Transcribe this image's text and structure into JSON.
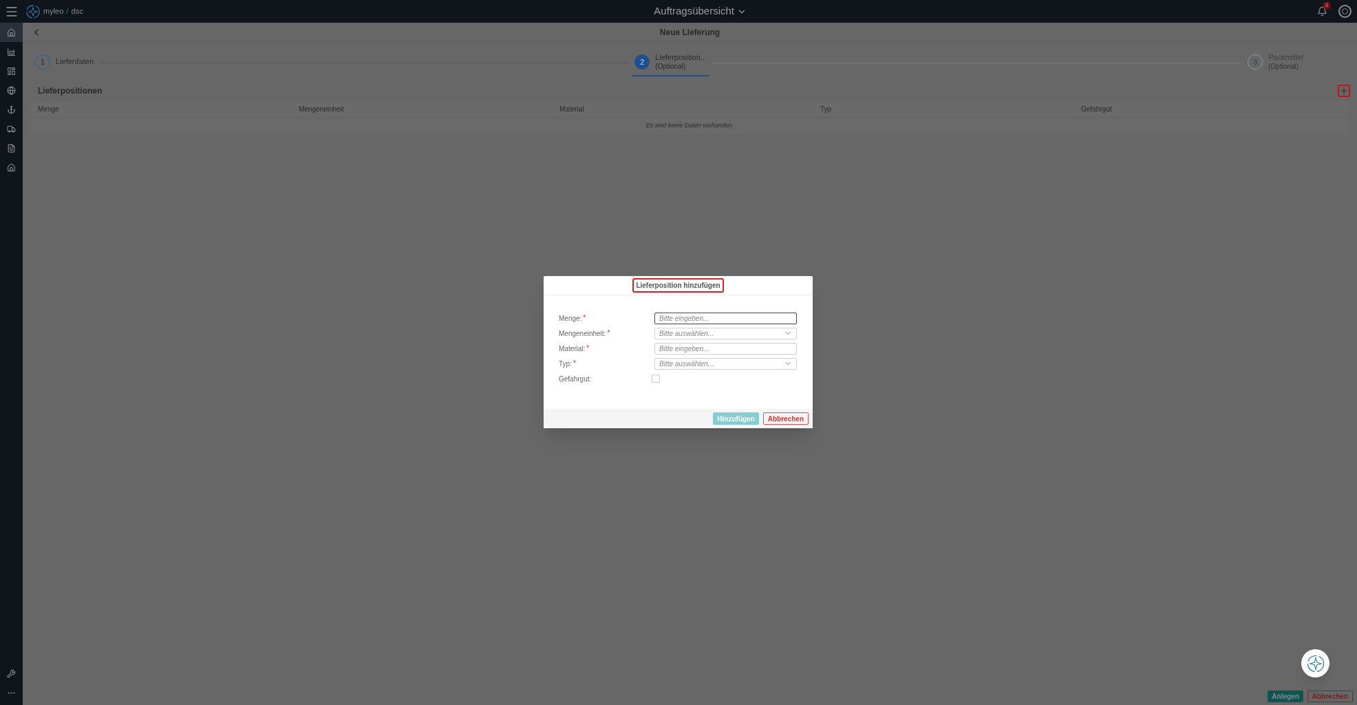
{
  "topbar": {
    "brand": "myleo",
    "separator": "/",
    "product": "dsc",
    "title": "Auftragsübersicht",
    "notification_count": "3"
  },
  "sidebar": {
    "items": [
      {
        "selected": true
      },
      {
        "selected": false
      },
      {
        "selected": false
      },
      {
        "selected": false
      },
      {
        "selected": false
      },
      {
        "selected": false
      },
      {
        "selected": false
      },
      {
        "selected": false
      }
    ],
    "bottom_items": [
      {
        "selected": false
      },
      {
        "selected": false
      }
    ]
  },
  "page": {
    "title": "Neue Lieferung"
  },
  "steps": [
    {
      "number": "1",
      "label": "Lieferdaten",
      "completed": true,
      "selected": false
    },
    {
      "number": "2",
      "label": "Lieferposition...",
      "sublabel": "(Optional)",
      "completed": false,
      "selected": true
    },
    {
      "number": "3",
      "label": "Packmittel",
      "sublabel": "(Optional)",
      "completed": false,
      "selected": false
    }
  ],
  "section": {
    "title": "Lieferpositionen"
  },
  "table": {
    "columns": [
      "Menge",
      "Mengeneinheit",
      "Material",
      "Typ",
      "Gefahrgut"
    ],
    "empty_text": "Es sind keine Daten vorhanden."
  },
  "dialog": {
    "title": "Lieferposition hinzufügen",
    "fields": [
      {
        "kind": "text",
        "label": "Menge:",
        "required_mark": "*",
        "placeholder": "Bitte eingeben...",
        "focused": true
      },
      {
        "kind": "select",
        "label": "Mengeneinheit:",
        "required_mark": "*",
        "placeholder": "Bitte auswählen...",
        "focused": false
      },
      {
        "kind": "text",
        "label": "Material:",
        "required_mark": "*",
        "placeholder": "Bitte eingeben...",
        "focused": false
      },
      {
        "kind": "select",
        "label": "Typ:",
        "required_mark": "*",
        "placeholder": "Bitte auswählen...",
        "focused": false
      },
      {
        "kind": "checkbox",
        "label": "Gefahrgut:",
        "checked": false
      }
    ],
    "buttons": [
      {
        "label": "Hinzufügen",
        "kind": "primary",
        "disabled": true
      },
      {
        "label": "Abbrechen",
        "kind": "secondary",
        "disabled": false
      }
    ]
  },
  "footer": {
    "buttons": [
      {
        "label": "Anlegen",
        "kind": "primary"
      },
      {
        "label": "Abbrechen",
        "kind": "secondary"
      }
    ]
  }
}
